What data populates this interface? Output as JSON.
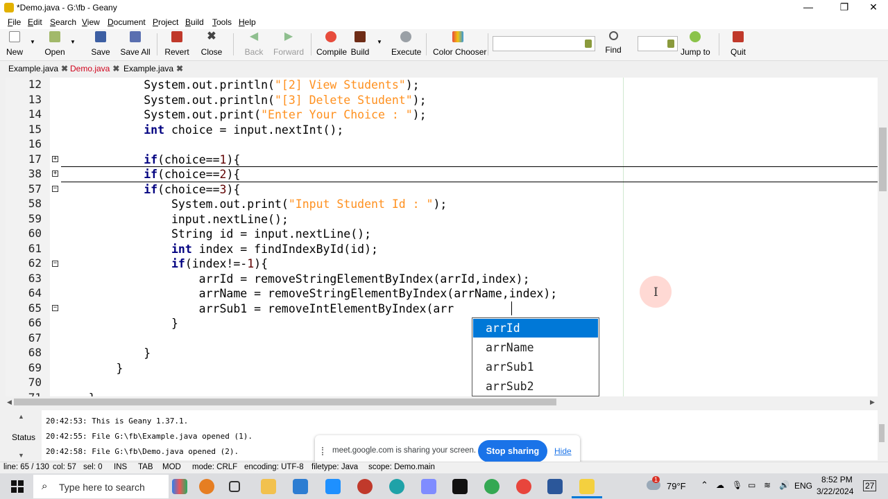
{
  "window": {
    "title": "*Demo.java - G:\\fb - Geany",
    "minimize": "—",
    "maximize": "❐",
    "close": "✕"
  },
  "menu": [
    "File",
    "Edit",
    "Search",
    "View",
    "Document",
    "Project",
    "Build",
    "Tools",
    "Help"
  ],
  "toolbar": {
    "new": "New",
    "open": "Open",
    "save": "Save",
    "save_all": "Save All",
    "revert": "Revert",
    "close": "Close",
    "back": "Back",
    "forward": "Forward",
    "compile": "Compile",
    "build": "Build",
    "execute": "Execute",
    "color_chooser": "Color Chooser",
    "find": "Find",
    "jump_to": "Jump to",
    "quit": "Quit",
    "search_value": "",
    "line_value": ""
  },
  "tabs": [
    {
      "label": "Example.java",
      "active": false
    },
    {
      "label": "Demo.java",
      "active": true
    },
    {
      "label": "Example.java",
      "active": false
    }
  ],
  "editor": {
    "line_numbers": [
      "12",
      "13",
      "14",
      "15",
      "16",
      "17",
      "38",
      "57",
      "58",
      "59",
      "60",
      "61",
      "62",
      "63",
      "64",
      "65",
      "66",
      "67",
      "68",
      "69",
      "70",
      "71"
    ]
  },
  "autocomplete": {
    "items": [
      "arrId",
      "arrName",
      "arrSub1",
      "arrSub2"
    ],
    "selected": "arrId"
  },
  "messages": {
    "label": "Status",
    "lines": [
      "20:42:53: This is Geany 1.37.1.",
      "20:42:55: File G:\\fb\\Example.java opened (1).",
      "20:42:58: File G:\\fb\\Demo.java opened (2)."
    ]
  },
  "share_bar": {
    "text": "meet.google.com is sharing your screen.",
    "stop": "Stop sharing",
    "hide": "Hide"
  },
  "statusbar": {
    "line": "line: 65 / 130",
    "col": "col: 57",
    "sel": "sel: 0",
    "ins": "INS",
    "tab": "TAB",
    "mod": "MOD",
    "mode": "mode: CRLF",
    "encoding": "encoding: UTF-8",
    "filetype": "filetype: Java",
    "scope": "scope: Demo.main"
  },
  "taskbar": {
    "search_placeholder": "Type here to search",
    "weather": "79°F",
    "lang": "ENG",
    "time": "8:52 PM",
    "date": "3/22/2024",
    "notifications": "27",
    "weather_badge": "1"
  },
  "colors": {
    "keyword": "#000080",
    "string": "#ff901e",
    "number": "#600000",
    "selection": "#0078d7",
    "share_button": "#1a73e8"
  }
}
